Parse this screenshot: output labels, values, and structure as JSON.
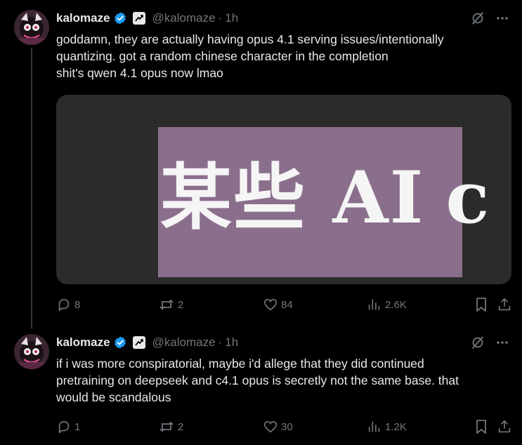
{
  "colors": {
    "background": "#000000",
    "text": "#e7e9ea",
    "muted": "#71767b",
    "verified": "#1d9bf0",
    "thread_line": "#333639",
    "media_bg": "#2b2b2b",
    "media_highlight": "#8a6f8c"
  },
  "tweets": [
    {
      "author": {
        "name": "kalomaze",
        "handle": "@kalomaze",
        "time": "1h",
        "separator": "·"
      },
      "text_lines": [
        "goddamn, they are actually having opus 4.1 serving issues/intentionally",
        "quantizing. got a random chinese character in the completion",
        "shit's qwen 4.1 opus now lmao"
      ],
      "media": {
        "text": "某些 AI",
        "partial_char": "c"
      },
      "stats": {
        "replies": "8",
        "retweets": "2",
        "likes": "84",
        "views": "2.6K"
      }
    },
    {
      "author": {
        "name": "kalomaze",
        "handle": "@kalomaze",
        "time": "1h",
        "separator": "·"
      },
      "text_lines": [
        "if i was more conspiratorial, maybe i'd allege that they did continued",
        "pretraining on deepseek and c4.1 opus is secretly not the same base. that",
        "would be scandalous"
      ],
      "stats": {
        "replies": "1",
        "retweets": "2",
        "likes": "30",
        "views": "1.2K"
      }
    }
  ],
  "icons": {
    "verified": "verified-badge-icon",
    "automated": "automated-account-icon",
    "grok": "grok-icon",
    "more": "more-icon",
    "reply": "reply-icon",
    "retweet": "retweet-icon",
    "like": "heart-icon",
    "views": "views-icon",
    "bookmark": "bookmark-icon",
    "share": "share-icon"
  }
}
